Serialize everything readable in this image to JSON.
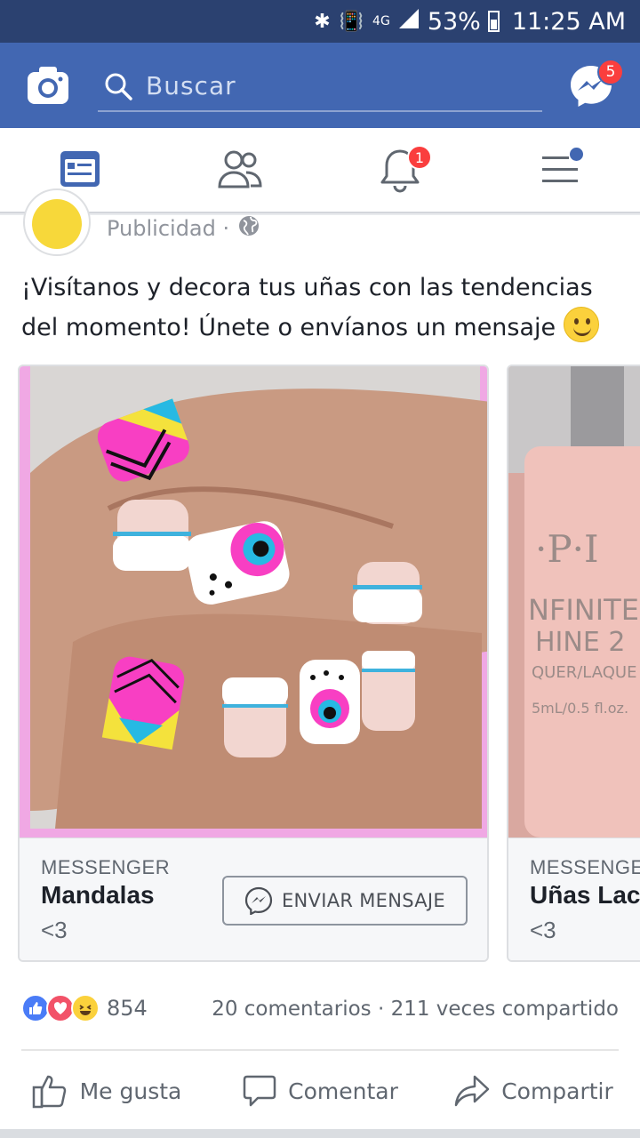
{
  "status_bar": {
    "network": "4G",
    "battery": "53%",
    "time": "11:25 AM"
  },
  "header": {
    "search_placeholder": "Buscar",
    "messenger_badge": "5"
  },
  "tabs": {
    "notifications_badge": "1",
    "items": [
      "news-feed",
      "friends",
      "notifications",
      "menu"
    ]
  },
  "post": {
    "sponsored_label": "Publicidad ·",
    "text": "¡Visítanos y decora tus uñas con las tendencias del momento! Únete o envíanos un mensaje",
    "cards": [
      {
        "kicker": "MESSENGER",
        "title": "Mandalas",
        "subtitle": "<3",
        "cta": "ENVIAR MENSAJE"
      },
      {
        "kicker": "MESSENGER",
        "title": "Uñas Lac",
        "subtitle": "<3"
      }
    ],
    "reaction_count": "854",
    "stats": "20 comentarios · 211 veces compartido",
    "actions": {
      "like": "Me gusta",
      "comment": "Comentar",
      "share": "Compartir"
    }
  },
  "colors": {
    "header_blue": "#4267b2",
    "status_bar": "#2b4170",
    "badge_red": "#fa3e3e"
  }
}
